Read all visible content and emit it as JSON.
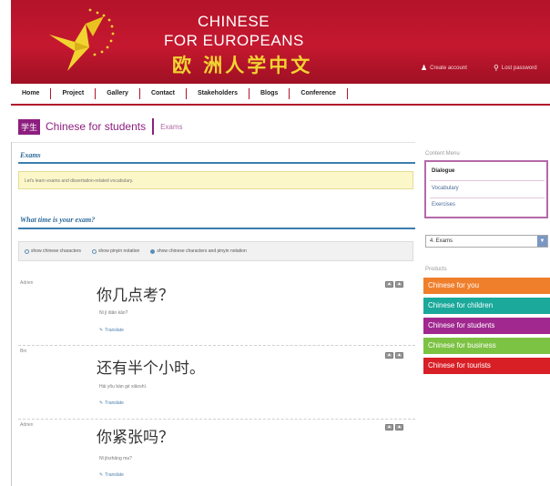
{
  "header": {
    "brand_line1": "CHINESE",
    "brand_line2": "FOR EUROPEANS",
    "brand_cn": "欧 洲人学中文",
    "create_account": "Create account",
    "lost_password": "Lost password",
    "bird_color": "#f2d431"
  },
  "nav": [
    "Home",
    "Project",
    "Gallery",
    "Contact",
    "Stakeholders",
    "Blogs",
    "Conference"
  ],
  "page": {
    "badge": "学生",
    "title": "Chinese for students",
    "tab": "Exams"
  },
  "exams": {
    "heading": "Exams",
    "notice": "Let's learn exams and dissertation-related vocabulary."
  },
  "question": {
    "heading": "What time is your exam?",
    "options": [
      {
        "label": "show chinese characters",
        "selected": false
      },
      {
        "label": "show pinyin notation",
        "selected": false
      },
      {
        "label": "show chinese characters and pinyin notation",
        "selected": true
      }
    ]
  },
  "dialogue": [
    {
      "speaker": "Adrien",
      "hanzi": "你几点考？",
      "pinyin": "Nǐ jǐ diǎn kǎo?",
      "translate": "Translate"
    },
    {
      "speaker": "Bin",
      "hanzi": "还有半个小时。",
      "pinyin": "Hái yǒu bàn gè xiǎoshí.",
      "translate": "Translate"
    },
    {
      "speaker": "Adrien",
      "hanzi": "你紧张吗？",
      "pinyin": "Nǐ jǐnzhāng ma?",
      "translate": "Translate"
    }
  ],
  "sidebar": {
    "content_menu_label": "Content Menu",
    "content_menu": [
      "Dialogue",
      "Vocabulary",
      "Exercises"
    ],
    "select_value": "4. Exams",
    "products_label": "Products",
    "products": [
      {
        "label": "Chinese for you",
        "color": "#f07f2c"
      },
      {
        "label": "Chinese for children",
        "color": "#1aa99b"
      },
      {
        "label": "Chinese for students",
        "color": "#a0288f"
      },
      {
        "label": "Chinese for business",
        "color": "#7cc243"
      },
      {
        "label": "Chinese for tourists",
        "color": "#d91f26"
      }
    ]
  },
  "colors": {
    "header_red": "#b3132a",
    "accent_purple": "#8d1e7f",
    "section_blue": "#2a6a9a"
  }
}
